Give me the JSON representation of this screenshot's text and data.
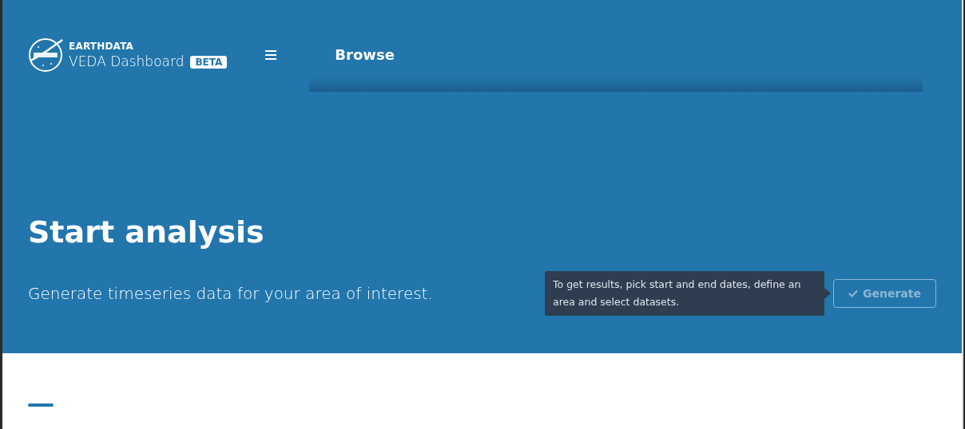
{
  "header": {
    "brand": "EARTHDATA",
    "title": "VEDA Dashboard",
    "badge": "BETA",
    "nav": [
      {
        "label": "Browse"
      }
    ]
  },
  "hero": {
    "title": "Start analysis",
    "subtitle": "Generate timeseries data for your area of interest.",
    "tooltip": "To get results, pick start and end dates, define an area and select datasets.",
    "button": {
      "label": "Generate",
      "disabled": true
    }
  }
}
